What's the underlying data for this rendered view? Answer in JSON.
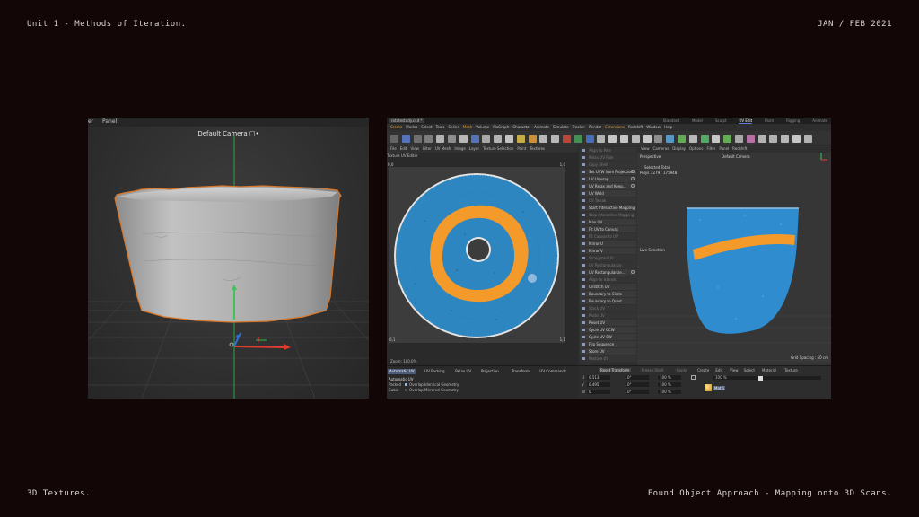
{
  "page": {
    "header_left": "Unit 1 - Methods of Iteration.",
    "header_right": "JAN / FEB 2021",
    "footer_left": "3D Textures.",
    "footer_right": "Found Object Approach - Mapping onto 3D Scans."
  },
  "left_viewport": {
    "menu": [
      "er",
      "Panel"
    ],
    "camera_label": "Default Camera",
    "camera_icon": "camera-lock-icon"
  },
  "right_app": {
    "file_tab": "rotatestudy.c4d *",
    "layouts": [
      "Standard",
      "Model",
      "Sculpt",
      "UV Edit",
      "Paint",
      "Rigging",
      "Animate"
    ],
    "active_layout": "UV Edit",
    "menu": [
      "Create",
      "Modes",
      "Select",
      "Tools",
      "Spline",
      "Mesh",
      "Volume",
      "MoGraph",
      "Character",
      "Animate",
      "Simulate",
      "Tracker",
      "Render",
      "Extensions",
      "Redshift",
      "Window",
      "Help"
    ],
    "highlight_menus": [
      "Create",
      "Mesh",
      "Extensions"
    ],
    "uv_editor": {
      "menu": [
        "File",
        "Edit",
        "View",
        "Filter",
        "UV Mesh",
        "Image",
        "Layer",
        "Texture Selection",
        "Paint",
        "Textures"
      ],
      "title": "Texture UV Editor",
      "corner_tl": "0,0",
      "corner_tr": "1,0",
      "corner_bl": "0,1",
      "corner_br": "1,1",
      "zoom": "Zoom: 100.0%"
    },
    "uv_commands": [
      {
        "label": "Align to Pole",
        "enabled": false
      },
      {
        "label": "Relax UV Pole",
        "enabled": false
      },
      {
        "label": "Copy Shell",
        "enabled": false
      },
      {
        "label": "Set UVW from Projection...",
        "enabled": true,
        "gear": true
      },
      {
        "label": "UV Unwrap...",
        "enabled": true,
        "gear": true
      },
      {
        "label": "UV Relax and Keep...",
        "enabled": true,
        "gear": true
      },
      {
        "label": "UV Weld",
        "enabled": true
      },
      {
        "label": "UV Tweak",
        "enabled": false
      },
      {
        "label": "Start Interactive Mapping",
        "enabled": true
      },
      {
        "label": "Stop Interactive Mapping",
        "enabled": false
      },
      {
        "label": "Max UV",
        "enabled": true
      },
      {
        "label": "Fit UV to Canvas",
        "enabled": true
      },
      {
        "label": "Fit Canvas to UV",
        "enabled": false
      },
      {
        "label": "Mirror U",
        "enabled": true
      },
      {
        "label": "Mirror V",
        "enabled": true
      },
      {
        "label": "Straighten UV",
        "enabled": false
      },
      {
        "label": "UV Rectangularize",
        "enabled": false
      },
      {
        "label": "UV Rectangularize...",
        "enabled": true,
        "gear": true
      },
      {
        "label": "Align to Islands",
        "enabled": false
      },
      {
        "label": "Unstitch UV",
        "enabled": true
      },
      {
        "label": "Boundary to Circle",
        "enabled": true
      },
      {
        "label": "Boundary to Quad",
        "enabled": true
      },
      {
        "label": "Stack UV",
        "enabled": false
      },
      {
        "label": "Paste UV",
        "enabled": false
      },
      {
        "label": "Reset UV",
        "enabled": true
      },
      {
        "label": "Cycle UV CCW",
        "enabled": true
      },
      {
        "label": "Cycle UV CW",
        "enabled": true
      },
      {
        "label": "Flip Sequence",
        "enabled": true
      },
      {
        "label": "Store UV",
        "enabled": true
      },
      {
        "label": "Restore UV",
        "enabled": false
      }
    ],
    "viewport": {
      "menu": [
        "View",
        "Cameras",
        "Display",
        "Options",
        "Filter",
        "Panel",
        "Redshift"
      ],
      "perspective": "Perspective",
      "camera": "Default Camera",
      "stats_header": "Selected  Total",
      "stats_polys_label": "Polys",
      "stats_selected": "22797",
      "stats_total": "175948",
      "uv_selection": "Live Selection",
      "grid_spacing": "Grid Spacing : 50 cm"
    },
    "bottom_tabs": [
      "Automatic UV",
      "UV Packing",
      "Relax UV",
      "Projection",
      "Transform",
      "UV Commands"
    ],
    "auto_uv": {
      "title": "Automatic UV",
      "opt1": "Packed",
      "opt2": "Cubic",
      "check1": "Overlap Identical Geometry",
      "check2": "Overlap Mirrored Geometry"
    },
    "transform": {
      "buttons": [
        "Reset Transform",
        "Freeze Shell",
        "Apply"
      ],
      "rows": [
        {
          "axis": "U",
          "v1": "0.513",
          "v2": "0°",
          "v3": "100 %"
        },
        {
          "axis": "V",
          "v1": "0.495",
          "v2": "0°",
          "v3": "100 %"
        },
        {
          "axis": "W",
          "v1": "0",
          "v2": "0°",
          "v3": "100 %"
        }
      ]
    },
    "material": {
      "menu": [
        "Create",
        "Edit",
        "View",
        "Select",
        "Material",
        "Texture"
      ],
      "name": "Mat.1",
      "zoom": "100 %"
    },
    "colors": {
      "uv_blue": "#2e86c1",
      "uv_orange": "#f39a2b",
      "mesh_blue": "#2f8ccf",
      "selection_orange": "#d9782a"
    }
  }
}
